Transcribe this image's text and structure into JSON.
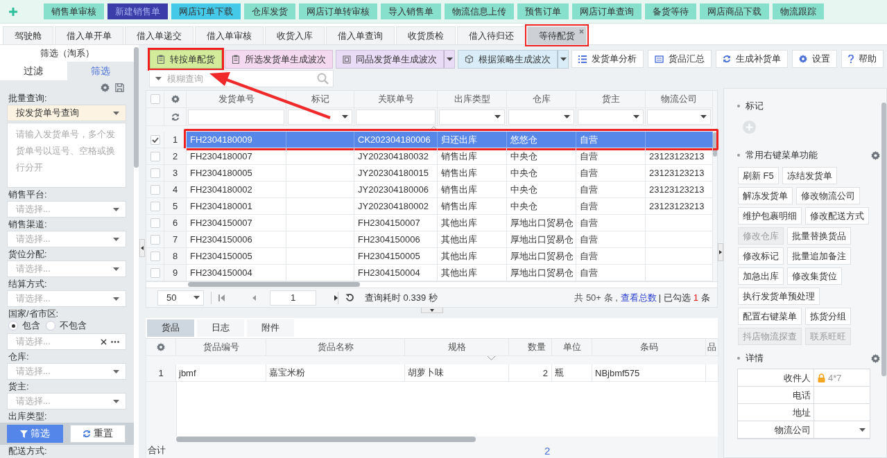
{
  "top_buttons": [
    {
      "label": "销售单审核",
      "color": "#86e0cc"
    },
    {
      "label": "新建销售单",
      "color": "#3b3da8"
    },
    {
      "label": "网店订单下载",
      "color": "#44c9e9"
    },
    {
      "label": "仓库发货",
      "color": "#86e0cc"
    },
    {
      "label": "网店订单转审核",
      "color": "#86e0cc"
    },
    {
      "label": "导入销售单",
      "color": "#86e0cc"
    },
    {
      "label": "物流信息上传",
      "color": "#86e0cc"
    },
    {
      "label": "预售订单",
      "color": "#86e0cc"
    },
    {
      "label": "网店订单查询",
      "color": "#86e0cc"
    },
    {
      "label": "备货等待",
      "color": "#86e0cc"
    },
    {
      "label": "网店商品下载",
      "color": "#86e0cc"
    },
    {
      "label": "物流跟踪",
      "color": "#86e0cc"
    }
  ],
  "page_tabs": [
    {
      "label": "驾驶舱",
      "selected": false,
      "highlighted": false
    },
    {
      "label": "借入单开单",
      "selected": false,
      "highlighted": false
    },
    {
      "label": "借入单递交",
      "selected": false,
      "highlighted": false
    },
    {
      "label": "借入单审核",
      "selected": false,
      "highlighted": false
    },
    {
      "label": "收货入库",
      "selected": false,
      "highlighted": false
    },
    {
      "label": "借入单查询",
      "selected": false,
      "highlighted": false
    },
    {
      "label": "收货质检",
      "selected": false,
      "highlighted": false
    },
    {
      "label": "借入待归还",
      "selected": false,
      "highlighted": false
    },
    {
      "label": "等待配货",
      "selected": true,
      "highlighted": true
    }
  ],
  "filter_panel": {
    "title": "筛选（淘系）",
    "tabs": [
      {
        "label": "过滤",
        "selected": false
      },
      {
        "label": "筛选",
        "selected": true
      }
    ],
    "batch": {
      "label": "批量查询:",
      "value": "按发货单号查询",
      "placeholder": "请输入发货单号，多个发货单号以逗号、空格或换行分开"
    },
    "fields": [
      {
        "label": "销售平台:",
        "kind": "select",
        "placeholder": "请选择..."
      },
      {
        "label": "销售渠道:",
        "kind": "select",
        "placeholder": "请选择..."
      },
      {
        "label": "货位分配:",
        "kind": "select",
        "placeholder": "请选择..."
      },
      {
        "label": "结算方式:",
        "kind": "select",
        "placeholder": "请选择..."
      },
      {
        "label": "国家/省市区:",
        "kind": "region",
        "placeholder": "请选择...",
        "options": [
          {
            "label": "包含",
            "selected": true
          },
          {
            "label": "不包含",
            "selected": false
          }
        ]
      },
      {
        "label": "仓库:",
        "kind": "select",
        "placeholder": "请选择..."
      },
      {
        "label": "货主:",
        "kind": "select",
        "placeholder": "请选择..."
      },
      {
        "label": "出库类型:",
        "kind": "label"
      }
    ],
    "buttons": [
      {
        "label": "筛选",
        "kind": "primary"
      },
      {
        "label": "重置",
        "kind": "default"
      }
    ],
    "trailing_label": "配送方式:"
  },
  "actions": [
    {
      "label": "转按单配货",
      "color": "#d3ec9c",
      "split": false,
      "highlighted": true
    },
    {
      "label": "所选发货单生成波次",
      "color": "#f5d9f1",
      "split": false,
      "highlighted": false
    },
    {
      "label": "同品发货单生成波次",
      "color": "#e8dcf6",
      "split": true,
      "highlighted": false
    },
    {
      "label": "根据策略生成波次",
      "color": "#d8edf8",
      "split": true,
      "highlighted": false
    }
  ],
  "tools": [
    {
      "label": "发货单分析"
    },
    {
      "label": "货品汇总"
    },
    {
      "label": "生成补货单"
    },
    {
      "label": "设置"
    },
    {
      "label": "帮助"
    }
  ],
  "search": {
    "placeholder": "模糊查询"
  },
  "table": {
    "all_checked": false,
    "columns": [
      {
        "label": "发货单号",
        "kind": "text"
      },
      {
        "label": "标记",
        "kind": "select"
      },
      {
        "label": "关联单号",
        "kind": "text"
      },
      {
        "label": "出库类型",
        "kind": "select"
      },
      {
        "label": "仓库",
        "kind": "select"
      },
      {
        "label": "货主",
        "kind": "select"
      },
      {
        "label": "物流公司",
        "kind": "select"
      }
    ],
    "rows": [
      {
        "no": "1",
        "checked": true,
        "selected": true,
        "highlighted": true,
        "order": "FH2304180009",
        "related": "CK202304180006",
        "type": "归还出库",
        "warehouse": "悠悠仓",
        "owner": "自营"
      },
      {
        "no": "2",
        "checked": false,
        "selected": false,
        "highlighted": false,
        "order": "FH2304180007",
        "related": "JY202304180032",
        "type": "销售出库",
        "warehouse": "中央仓",
        "owner": "自营",
        "logistics": "23123123213"
      },
      {
        "no": "3",
        "checked": false,
        "selected": false,
        "highlighted": false,
        "order": "FH2304180005",
        "related": "JY202304180015",
        "type": "销售出库",
        "warehouse": "中央仓",
        "owner": "自营",
        "logistics": "23123123213"
      },
      {
        "no": "4",
        "checked": false,
        "selected": false,
        "highlighted": false,
        "order": "FH2304180002",
        "related": "JY202304180006",
        "type": "销售出库",
        "warehouse": "中央仓",
        "owner": "自营",
        "logistics": "23123123213"
      },
      {
        "no": "5",
        "checked": false,
        "selected": false,
        "highlighted": false,
        "order": "FH2304180001",
        "related": "JY202304180002",
        "type": "销售出库",
        "warehouse": "中央仓",
        "owner": "自营",
        "logistics": "23123123213"
      },
      {
        "no": "6",
        "checked": false,
        "selected": false,
        "highlighted": false,
        "order": "FH2304150007",
        "related": "FH2304150007",
        "type": "其他出库",
        "warehouse": "厚地出口贸易仓",
        "owner": "自营"
      },
      {
        "no": "7",
        "checked": false,
        "selected": false,
        "highlighted": false,
        "order": "FH2304150006",
        "related": "FH2304150006",
        "type": "其他出库",
        "warehouse": "厚地出口贸易仓",
        "owner": "自营"
      },
      {
        "no": "8",
        "checked": false,
        "selected": false,
        "highlighted": false,
        "order": "FH2304150005",
        "related": "FH2304150005",
        "type": "其他出库",
        "warehouse": "厚地出口贸易仓",
        "owner": "自营"
      },
      {
        "no": "9",
        "checked": false,
        "selected": false,
        "highlighted": false,
        "order": "FH2304150004",
        "related": "FH2304150004",
        "type": "其他出库",
        "warehouse": "厚地出口贸易仓",
        "owner": "自营"
      }
    ]
  },
  "pager": {
    "page_size": "50",
    "page": "1",
    "elapsed": "查询耗时 0.339 秒",
    "total": "共 50+ 条 ,",
    "total_link": "查看总数",
    "checked_prefix": "| 已勾选",
    "checked_count": "1",
    "checked_suffix": "条"
  },
  "detail": {
    "tabs": [
      {
        "label": "货品",
        "selected": true
      },
      {
        "label": "日志",
        "selected": false
      },
      {
        "label": "附件",
        "selected": false
      }
    ],
    "columns": [
      "货品编号",
      "货品名称",
      "规格",
      "数量",
      "单位",
      "条码",
      "品"
    ],
    "rows": [
      {
        "no": "1",
        "code": "jbmf",
        "name": "嘉宝米粉",
        "spec": "胡萝卜味",
        "qty": "2",
        "unit": "瓶",
        "barcode": "NBjbmf575"
      }
    ],
    "footer": {
      "label": "合计",
      "qty": "2"
    }
  },
  "side": {
    "tags_title": "标记",
    "menu_title": "常用右键菜单功能",
    "menu": [
      {
        "label": "刷新 F5",
        "disabled": false
      },
      {
        "label": "冻结发货单",
        "disabled": false
      },
      {
        "label": "解冻发货单",
        "disabled": false
      },
      {
        "label": "修改物流公司",
        "disabled": false
      },
      {
        "label": "维护包裹明细",
        "disabled": false
      },
      {
        "label": "修改配送方式",
        "disabled": false
      },
      {
        "label": "修改仓库",
        "disabled": true
      },
      {
        "label": "批量替换货品",
        "disabled": false
      },
      {
        "label": "修改标记",
        "disabled": false
      },
      {
        "label": "批量追加备注",
        "disabled": false
      },
      {
        "label": "加急出库",
        "disabled": false
      },
      {
        "label": "修改集货位",
        "disabled": false
      },
      {
        "label": "执行发货单预处理",
        "disabled": false
      },
      {
        "label": "配置右键菜单",
        "disabled": false
      },
      {
        "label": "拣货分组",
        "disabled": false
      },
      {
        "label": "抖店物流探查",
        "disabled": true
      },
      {
        "label": "联系旺旺",
        "disabled": true
      }
    ],
    "detail_title": "详情",
    "detail_rows": [
      {
        "label": "收件人",
        "kind": "text",
        "locked": true,
        "value": "4*7"
      },
      {
        "label": "电话",
        "kind": "text"
      },
      {
        "label": "地址",
        "kind": "text"
      },
      {
        "label": "物流公司",
        "kind": "select"
      }
    ]
  }
}
